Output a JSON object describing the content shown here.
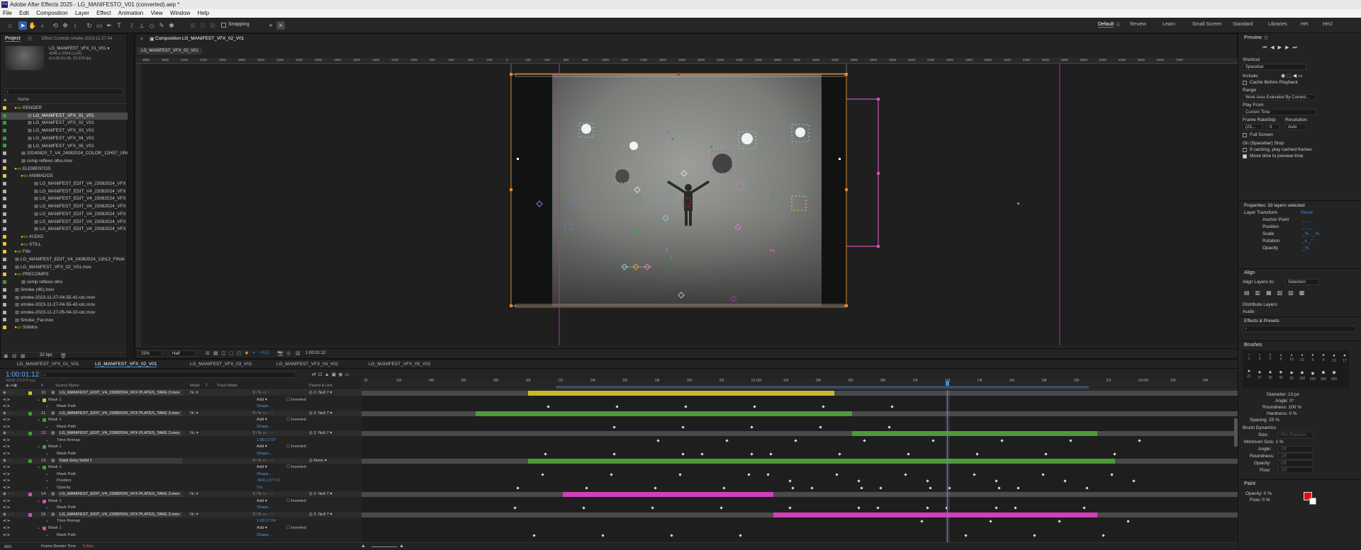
{
  "app": {
    "title": "Adobe After Effects 2025 - LG_MANIFESTO_V01 (converted).aep *",
    "logo": "Ae"
  },
  "menu": [
    "File",
    "Edit",
    "Composition",
    "Layer",
    "Effect",
    "Animation",
    "View",
    "Window",
    "Help"
  ],
  "toolbar": {
    "snapping": "Snapping",
    "tool_icons": [
      "home-icon",
      "selection-icon",
      "hand-icon",
      "zoom-icon",
      "orbit-icon",
      "pan-icon",
      "dolly-icon",
      "rotate-icon",
      "rectangle-icon",
      "pen-icon",
      "type-icon",
      "brush-icon",
      "clone-icon",
      "eraser-icon",
      "roto-icon",
      "puppet-icon"
    ]
  },
  "workspaces": [
    "Default",
    "Review",
    "Learn",
    "Small Screen",
    "Standard",
    "Libraries",
    "HH",
    "HH2"
  ],
  "project": {
    "tab": "Project",
    "effect_tab": "Effect Controls smoke-2023-11-27-04",
    "preview_name": "LG_MANIFEST_VFX_01_V01 ▾",
    "preview_info1": "4096 x 2304 (1,00)",
    "preview_info2": "Δ 0:00:01:05, 23,976 fps",
    "col_name": "Name",
    "bpc": "32 bpc",
    "items": [
      {
        "t": "RENDER",
        "d": 0,
        "c": "#e8c531",
        "f": true
      },
      {
        "t": "LG_MANIFEST_VFX_01_V01",
        "d": 2,
        "c": "#3a9a3a",
        "s": true
      },
      {
        "t": "LG_MANIFEST_VFX_02_V01",
        "d": 2,
        "c": "#3a9a3a"
      },
      {
        "t": "LG_MANIFEST_VFX_03_V01",
        "d": 2,
        "c": "#3a9a3a"
      },
      {
        "t": "LG_MANIFEST_VFX_04_V01",
        "d": 2,
        "c": "#3a9a3a"
      },
      {
        "t": "LG_MANIFEST_VFX_05_V01",
        "d": 2,
        "c": "#3a9a3a"
      },
      {
        "t": "20240820_T_V4_24082024_COLOR_12H57_UNCO",
        "d": 1,
        "c": "#b0b0b0"
      },
      {
        "t": "comp reflexo olho.mov",
        "d": 1,
        "c": "#b0b0b0"
      },
      {
        "t": "ELEMENTOS",
        "d": 0,
        "c": "#e8c531",
        "f": true
      },
      {
        "t": "ANIMADOS",
        "d": 1,
        "c": "#e8c531",
        "f": true
      },
      {
        "t": "LG_MANIFEST_EDIT_V4_23082024_VFX I",
        "d": 3,
        "c": "#b0b0b0"
      },
      {
        "t": "LG_MANIFEST_EDIT_V4_23082024_VFX I",
        "d": 3,
        "c": "#b0b0b0"
      },
      {
        "t": "LG_MANIFEST_EDIT_V4_23082024_VFX I",
        "d": 3,
        "c": "#b0b0b0"
      },
      {
        "t": "LG_MANIFEST_EDIT_V4_23082024_VFX I",
        "d": 3,
        "c": "#b0b0b0"
      },
      {
        "t": "LG_MANIFEST_EDIT_V4_23082024_VFX I",
        "d": 3,
        "c": "#b0b0b0"
      },
      {
        "t": "LG_MANIFEST_EDIT_V4_23082024_VFX I",
        "d": 3,
        "c": "#b0b0b0"
      },
      {
        "t": "LG_MANIFEST_EDIT_V4_23082024_VFX I",
        "d": 3,
        "c": "#b0b0b0"
      },
      {
        "t": "AUDIO",
        "d": 1,
        "c": "#e8c531",
        "f": true
      },
      {
        "t": "STILL",
        "d": 1,
        "c": "#e8c531",
        "f": true
      },
      {
        "t": "Fills",
        "d": 0,
        "c": "#e8c531",
        "f": true
      },
      {
        "t": "LG_MANIFEST_EDIT_V4_24082024_13h12_FINAl",
        "d": 0,
        "c": "#b0b0b0"
      },
      {
        "t": "LG_MANIFEST_VFX_02_V01.mov",
        "d": 0,
        "c": "#b0b0b0"
      },
      {
        "t": "PRECOMPS",
        "d": 0,
        "c": "#e8c531",
        "f": true
      },
      {
        "t": "comp reflexo olho",
        "d": 1,
        "c": "#3a9a3a"
      },
      {
        "t": "Smoke (4K).mov",
        "d": 0,
        "c": "#b0b0b0"
      },
      {
        "t": "smoke-2023-11-27-04-55-41-utc.mov",
        "d": 0,
        "c": "#b0b0b0"
      },
      {
        "t": "smoke-2023-11-27-04-55-42-utc.mov",
        "d": 0,
        "c": "#b0b0b0"
      },
      {
        "t": "smoke-2023-11-27-05-04-10-utc.mov",
        "d": 0,
        "c": "#b0b0b0"
      },
      {
        "t": "Smoke_Far.mov",
        "d": 0,
        "c": "#b0b0b0"
      },
      {
        "t": "Sólidos",
        "d": 0,
        "c": "#e8c531",
        "f": true
      }
    ]
  },
  "comp": {
    "tab": "Composition LG_MANIFEST_VFX_02_V01",
    "subtab": "LG_MANIFEST_VFX_02_V01",
    "ruler": [
      "3800",
      "3600",
      "3400",
      "3200",
      "3000",
      "2800",
      "2600",
      "2400",
      "2200",
      "2000",
      "1800",
      "1600",
      "1400",
      "1200",
      "1000",
      "800",
      "600",
      "400",
      "200",
      "0",
      "200",
      "400",
      "600",
      "800",
      "1000",
      "1200",
      "1400",
      "1600",
      "1800",
      "2000",
      "2200",
      "2400",
      "2600",
      "2800",
      "3000",
      "3200",
      "3400",
      "3600",
      "3800",
      "4000",
      "4200",
      "4400",
      "4600",
      "4800",
      "5000",
      "5200",
      "5400",
      "5600",
      "5800",
      "6000",
      "6200",
      "6400",
      "6600",
      "6800",
      "7000"
    ],
    "zoom": "25%",
    "res": "Half",
    "exposure": "+0,0",
    "timecode": "1:00:01:12"
  },
  "comp_tabs": [
    "LG_MANIFEST_VFX_01_V01",
    "LG_MANIFEST_VFX_02_V01",
    "LG_MANIFEST_VFX_03_V01",
    "LG_MANIFEST_VFX_04_V01",
    "LG_MANIFEST_VFX_05_V01"
  ],
  "timeline": {
    "timecode": "1:00:01:12",
    "frames": "00036 (23.976 fps)",
    "cols": {
      "num": "#",
      "src": "Source Name",
      "mode": "Mode",
      "t": "T",
      "matte": "Track Matte",
      "parent": "Parent & Link"
    },
    "ruler": [
      "0f",
      "02f",
      "04f",
      "06f",
      "08f",
      "10f",
      "12f",
      "14f",
      "16f",
      "18f",
      "20f",
      "22f",
      "01:00f",
      "02f",
      "04f",
      "06f",
      "08f",
      "10f",
      "12f",
      "14f",
      "16f",
      "18f",
      "20f",
      "22f",
      "02:00f",
      "02f",
      "04f"
    ],
    "footer": "Frame Render Time",
    "footer_val": "5,8ms",
    "rows": [
      {
        "k": "L",
        "num": "10",
        "name": "LG_MANIFEST_EDIT_V4_23082024_VFX PLATES_TAKE 2.mov",
        "c": "#d4c230",
        "parent": "2. Null 7",
        "bar": "#c8b92c",
        "bs": 0.19,
        "be": 0.54,
        "mode": "Nc"
      },
      {
        "k": "S",
        "name": "Mask 1",
        "val": "Add",
        "val2": "Inverted",
        "c": "#d4c230"
      },
      {
        "k": "P",
        "name": "Mask Path",
        "val": "Shape..."
      },
      {
        "k": "L",
        "num": "11",
        "name": "LG_MANIFEST_EDIT_V4_23082024_VFX PLATES_TAKE 2.mov",
        "c": "#3aa03a",
        "parent": "2. Null 7",
        "bar": "#4e9a3a",
        "bs": 0.13,
        "be": 0.56,
        "mode": "Nc"
      },
      {
        "k": "S",
        "name": "Mask 1",
        "val": "Add",
        "val2": "Inverted",
        "c": "#3aa03a"
      },
      {
        "k": "P",
        "name": "Mask Path",
        "val": "Shape..."
      },
      {
        "k": "L",
        "num": "12",
        "name": "LG_MANIFEST_EDIT_V4_23082024_VFX PLATES_TAKE 2.mov",
        "c": "#3aa03a",
        "parent": "2. Null 7",
        "bar": "#4e9a3a",
        "bs": 0.56,
        "be": 0.84,
        "mode": "Nc"
      },
      {
        "k": "P",
        "name": "Time Remap",
        "val": "1:00:17:07"
      },
      {
        "k": "S",
        "name": "Mask 1",
        "val": "Add",
        "val2": "Inverted",
        "c": "#3aa03a"
      },
      {
        "k": "P",
        "name": "Mask Path",
        "val": "Shape..."
      },
      {
        "k": "L",
        "num": "13",
        "name": "Dark Grey Solid 1",
        "c": "#3aa03a",
        "parent": "None",
        "bar": "#4e9a3a",
        "bs": 0.19,
        "be": 0.86,
        "mode": ""
      },
      {
        "k": "S",
        "name": "Mask 1",
        "val": "Add",
        "val2": "Inverted",
        "c": "#3aa03a"
      },
      {
        "k": "P",
        "name": "Mask Path",
        "val": "Shape..."
      },
      {
        "k": "P",
        "name": "Position",
        "val": "-562,1,577,0"
      },
      {
        "k": "P",
        "name": "Opacity",
        "val": "1%"
      },
      {
        "k": "L",
        "num": "14",
        "name": "LG_MANIFEST_EDIT_V4_23082024_VFX PLATES_TAKE 2.mov",
        "c": "#d24fb4",
        "parent": "2. Null 7",
        "bar": "#d23fba",
        "bs": 0.23,
        "be": 0.47,
        "mode": "Nc"
      },
      {
        "k": "S",
        "name": "Mask 1",
        "val": "Add",
        "val2": "Inverted",
        "c": "#d24fb4"
      },
      {
        "k": "P",
        "name": "Mask Path",
        "val": "Shape..."
      },
      {
        "k": "L",
        "num": "15",
        "name": "LG_MANIFEST_EDIT_V4_23082024_VFX PLATES_TAKE 2.mov",
        "c": "#d24fb4",
        "parent": "2. Null 7",
        "bar": "#d23fba",
        "bs": 0.47,
        "be": 0.84,
        "mode": "Nc"
      },
      {
        "k": "P",
        "name": "Time Remap",
        "val": "1:00:17:04"
      },
      {
        "k": "S",
        "name": "Mask 1",
        "val": "Add",
        "val2": "Inverted",
        "c": "#d24fb4"
      },
      {
        "k": "P",
        "name": "Mask Path",
        "val": "Shape..."
      }
    ]
  },
  "right": {
    "preview": {
      "title": "Preview",
      "shortcut": "Shortcut",
      "shortcut_val": "Spacebar",
      "include": "Include:",
      "cache": "Cache Before Playback",
      "range": "Range",
      "range_val": "Work Area Extended By Current...",
      "play_from": "Play From",
      "play_from_val": "Current Time",
      "frame_rate": "Frame Rate",
      "skip": "Skip",
      "resolution": "Resolution",
      "fr_val": "(23,...",
      "skip_val": "0",
      "res_val": "Auto",
      "full_screen": "Full Screen",
      "stop": "On (Spacebar) Stop:",
      "if_caching": "If caching, play cached frames",
      "move_time": "Move time to preview time"
    },
    "properties": {
      "title": "Properties: 33 layers selected",
      "layer_transform": "Layer Transform",
      "reset": "Reset",
      "props": [
        "Anchor Point",
        "Position",
        "Scale",
        "Rotation",
        "Opacity"
      ],
      "vals": [
        "_ , _",
        "_ , _",
        "_% , _%",
        "_x _°",
        "_%"
      ]
    },
    "align": {
      "title": "Align",
      "align_to": "Align Layers to:",
      "align_val": "Selection",
      "distribute": "Distribute Layers"
    },
    "audio": "Audio",
    "effects": "Effects & Presets",
    "brushes": {
      "title": "Brushes",
      "diameter": "Diameter: 13 px",
      "angle": "Angle: 0°",
      "roundness": "Roundness: 100 %",
      "hardness": "Hardness: 0 %",
      "spacing": "Spacing: 25 %",
      "dynamics": "Brush Dynamics",
      "size": "Size:",
      "size_val": "Pen Pressure",
      "min_size": "Minimum Size: 1 %",
      "angle2": "Angle:",
      "roundness2": "Roundness:",
      "opacity": "Opacity:",
      "flow": "Flow:",
      "off": "Off",
      "sizes": [
        "1",
        "3",
        "5",
        "9",
        "13",
        "19",
        "5",
        "9",
        "13",
        "17",
        "21",
        "27",
        "35",
        "45",
        "65",
        "100",
        "200",
        "300",
        "500"
      ]
    },
    "paint": {
      "title": "Paint",
      "opacity": "Opacity: 0 %",
      "flow": "Flow: 0 %",
      "color": "#e01010"
    }
  }
}
